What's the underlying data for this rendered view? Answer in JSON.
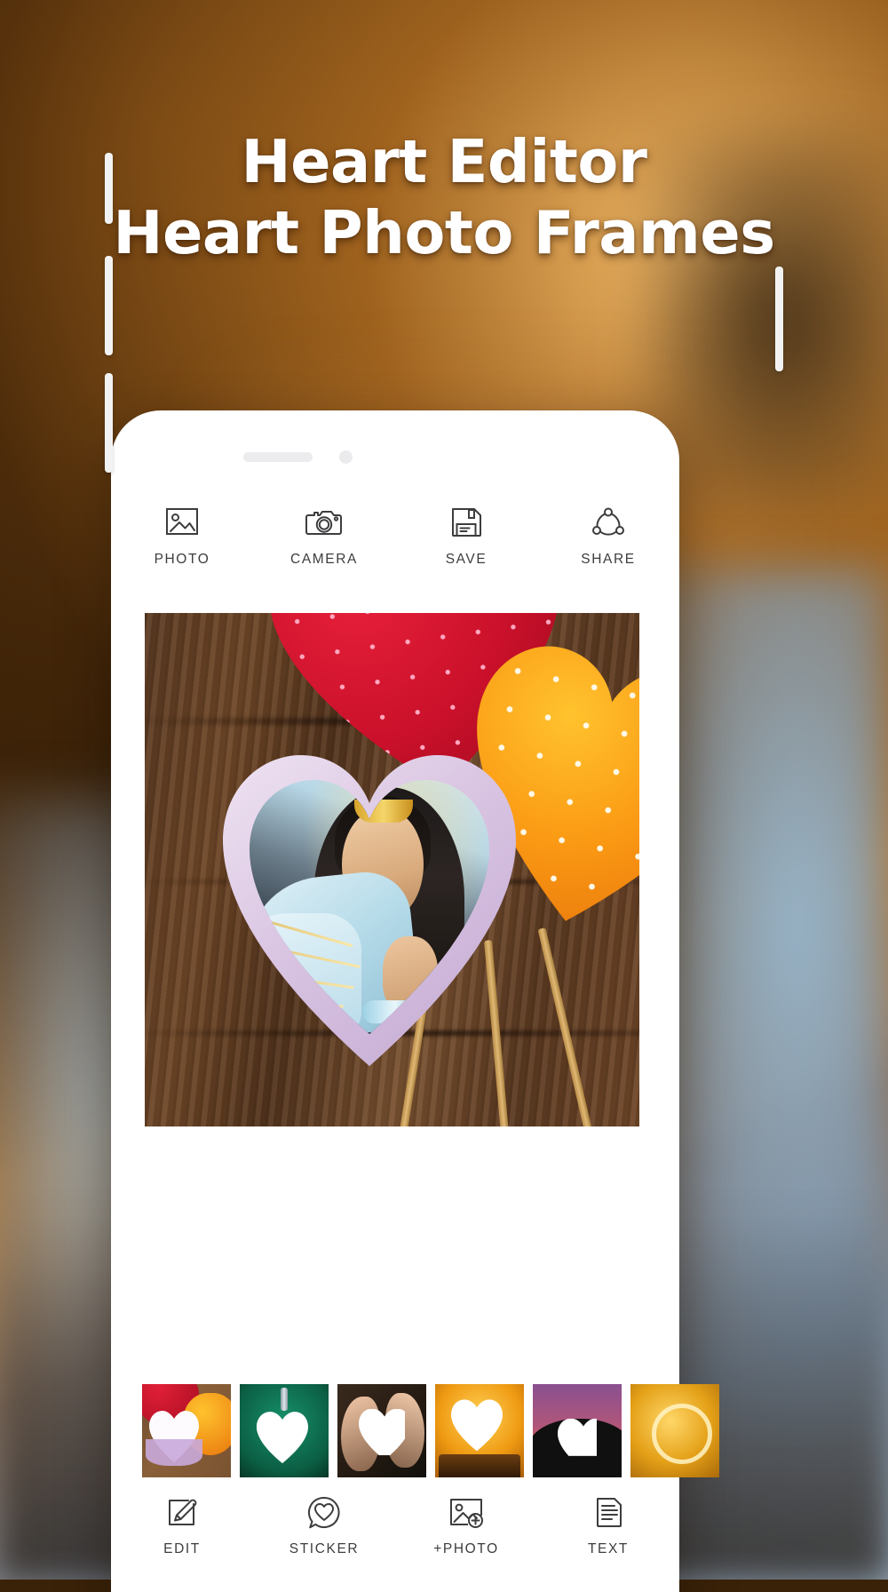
{
  "promo": {
    "title_line1": "Heart Editor",
    "title_line2": "Heart Photo Frames",
    "title_color": "#ffffff",
    "background_colors": [
      "#46280c",
      "#b4722a",
      "#93a6b6"
    ]
  },
  "app": {
    "top_toolbar": [
      {
        "label": "PHOTO",
        "icon": "image-icon"
      },
      {
        "label": "CAMERA",
        "icon": "camera-icon"
      },
      {
        "label": "SAVE",
        "icon": "floppy-disk-icon"
      },
      {
        "label": "SHARE",
        "icon": "share-nodes-icon"
      }
    ],
    "canvas": {
      "description": "Heart photo frame preview with red and orange polka-dot heart pillows on wood, lavender heart frame containing portrait photo"
    },
    "frame_thumbnails": [
      {
        "name": "heart-pillows-frame",
        "colors": [
          "#c9102a",
          "#fb9a14",
          "#c3a9d2"
        ]
      },
      {
        "name": "heart-locket-frame",
        "colors": [
          "#0d6b4f",
          "#c9cdd2"
        ]
      },
      {
        "name": "hands-heart-frame",
        "colors": [
          "#3b2a1c",
          "#e8bb9b"
        ]
      },
      {
        "name": "book-heart-frame",
        "colors": [
          "#e08a12",
          "#fbc23a"
        ]
      },
      {
        "name": "silhouette-heart-frame",
        "colors": [
          "#8a4f84",
          "#e8604a",
          "#111111"
        ]
      },
      {
        "name": "gold-heart-frame",
        "colors": [
          "#e0a21a",
          "#ffd769"
        ]
      }
    ],
    "bottom_nav": [
      {
        "label": "EDIT",
        "icon": "pencil-edit-icon"
      },
      {
        "label": "STICKER",
        "icon": "heart-bubble-icon"
      },
      {
        "label": "+PHOTO",
        "icon": "add-photo-icon"
      },
      {
        "label": "TEXT",
        "icon": "text-document-icon"
      }
    ],
    "ui_colors": {
      "icon_stroke": "#3d3d3f",
      "phone_body": "#ffffff"
    }
  }
}
